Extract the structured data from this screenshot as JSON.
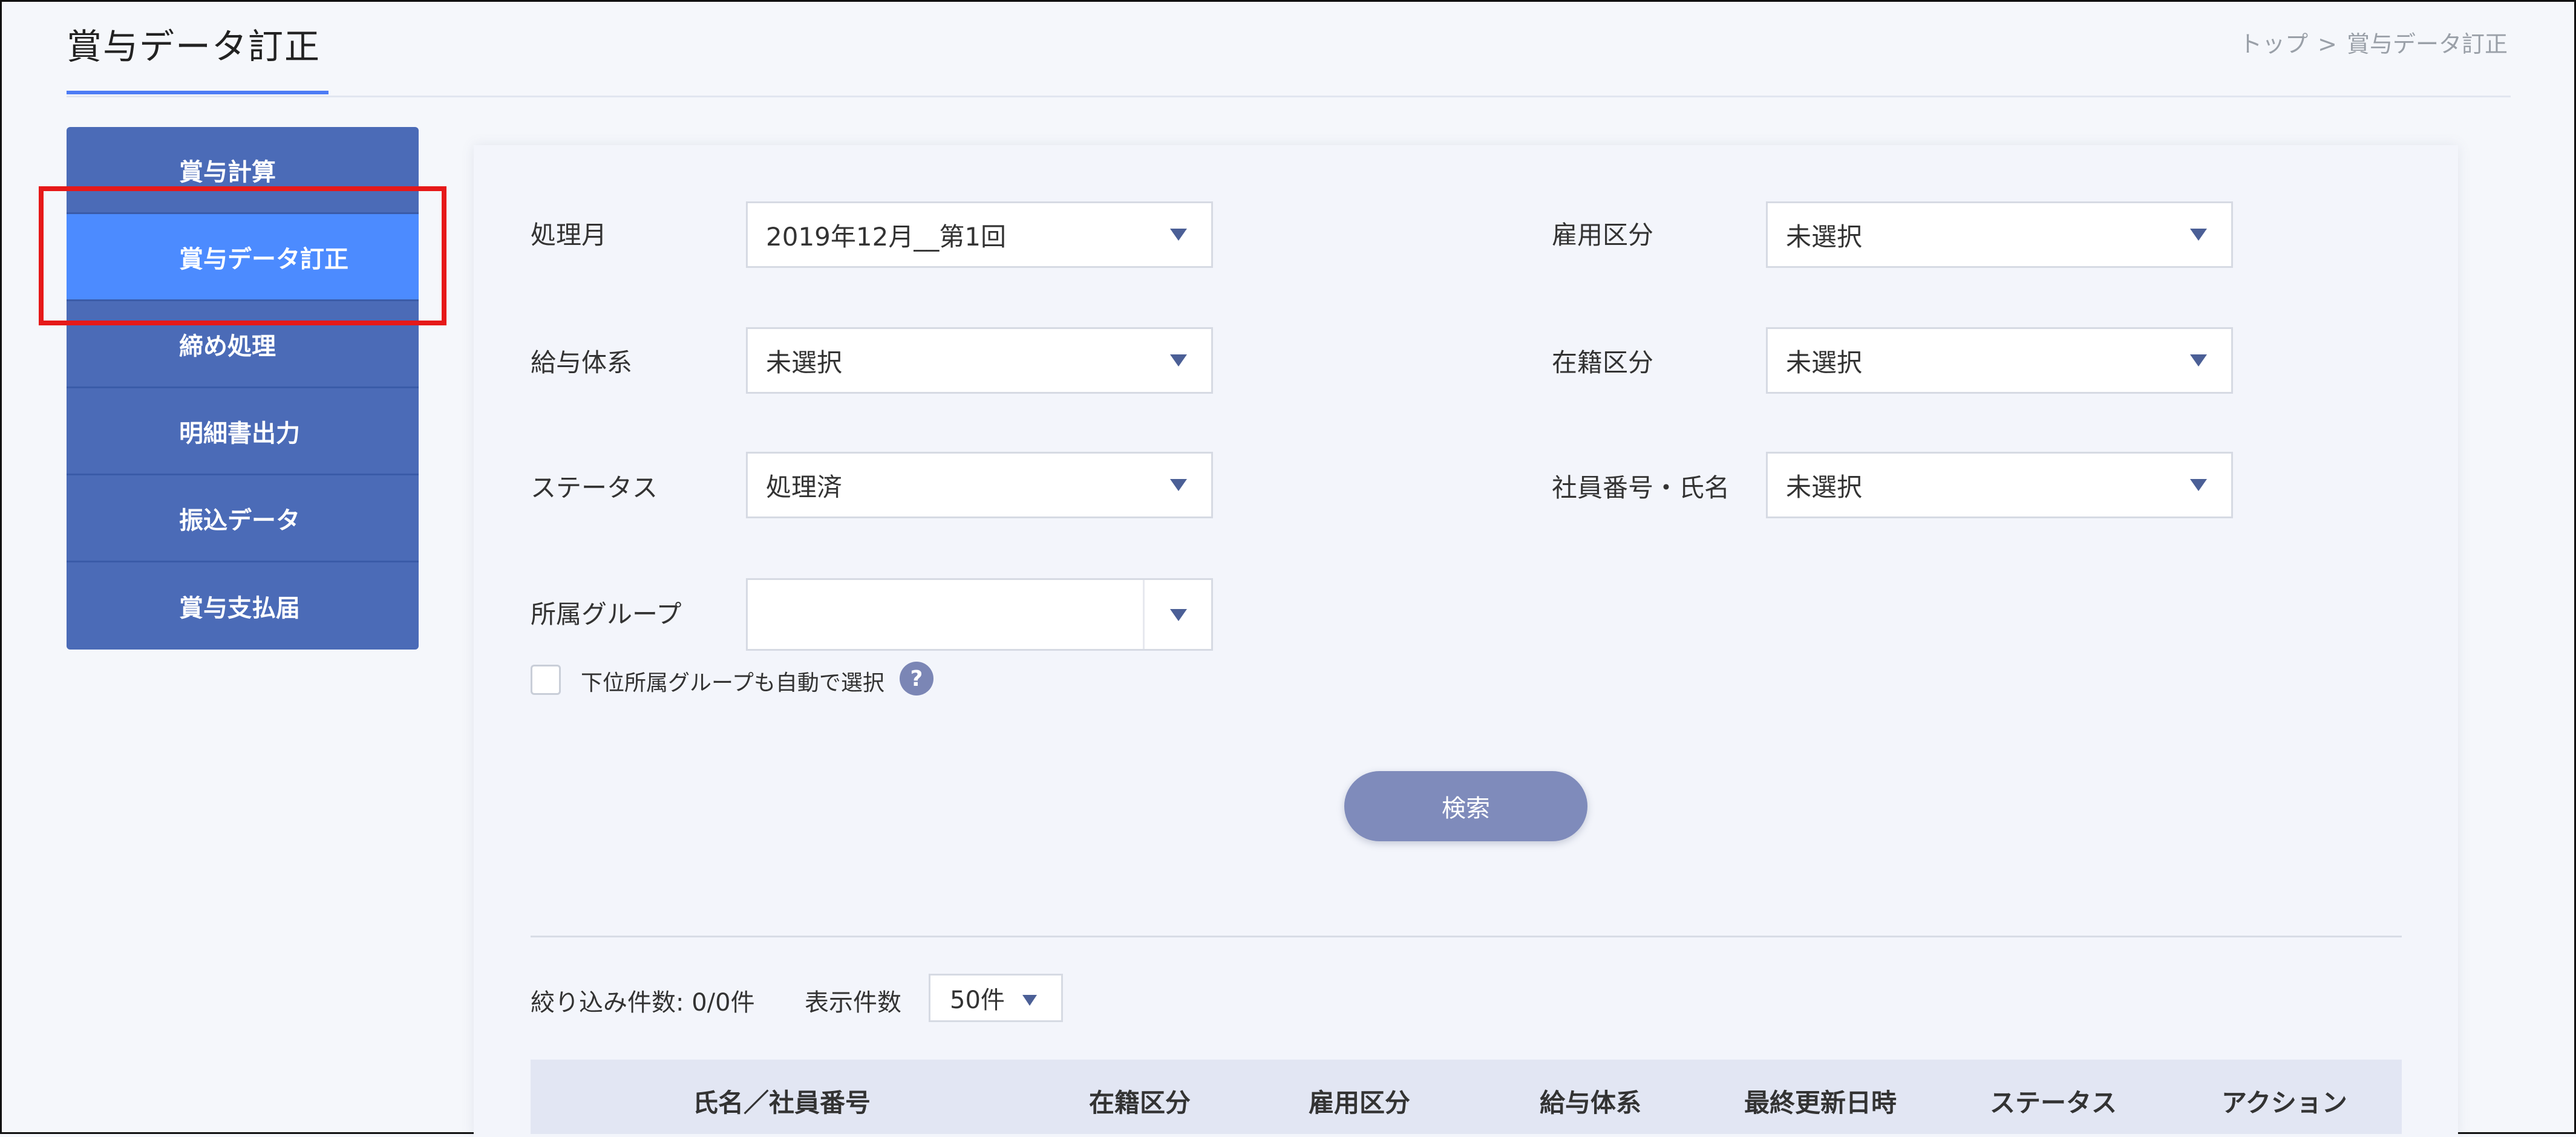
{
  "header": {
    "title": "賞与データ訂正",
    "breadcrumb": {
      "home": "トップ",
      "separator": ">",
      "current": "賞与データ訂正"
    }
  },
  "sidebar": {
    "items": [
      {
        "label": "賞与計算"
      },
      {
        "label": "賞与データ訂正"
      },
      {
        "label": "締め処理"
      },
      {
        "label": "明細書出力"
      },
      {
        "label": "振込データ"
      },
      {
        "label": "賞与支払届"
      }
    ]
  },
  "filters": {
    "processing_month": {
      "label": "処理月",
      "value": "2019年12月__第1回"
    },
    "employment_type": {
      "label": "雇用区分",
      "value": "未選択"
    },
    "salary_system": {
      "label": "給与体系",
      "value": "未選択"
    },
    "enrollment_type": {
      "label": "在籍区分",
      "value": "未選択"
    },
    "status": {
      "label": "ステータス",
      "value": "処理済"
    },
    "employee": {
      "label": "社員番号・氏名",
      "value": "未選択"
    },
    "group": {
      "label": "所属グループ",
      "value": ""
    },
    "subgroup_checkbox_label": "下位所属グループも自動で選択",
    "help": "?"
  },
  "search_button": "検索",
  "results": {
    "count_text": "絞り込み件数: 0/0件",
    "per_page_label": "表示件数",
    "per_page_value": "50件"
  },
  "table": {
    "headers": [
      "氏名／社員番号",
      "在籍区分",
      "雇用区分",
      "給与体系",
      "最終更新日時",
      "ステータス",
      "アクション"
    ]
  }
}
